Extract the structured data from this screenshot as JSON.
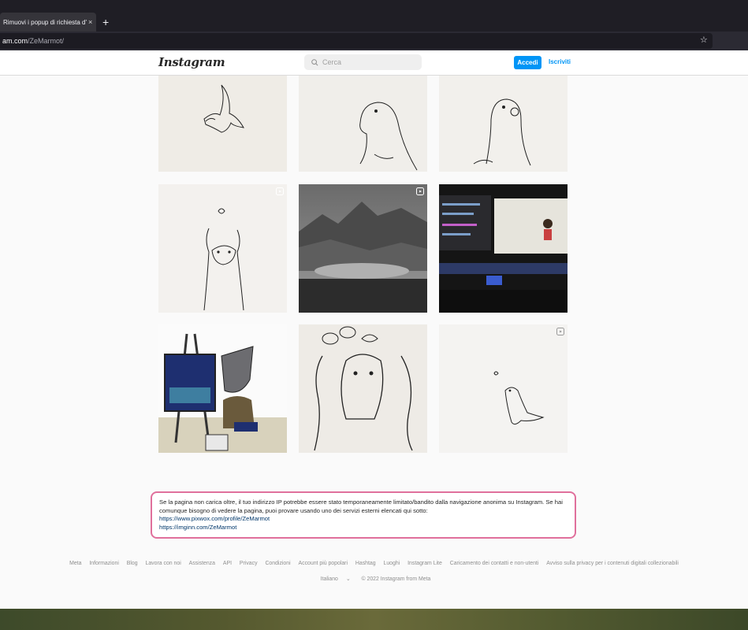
{
  "browser": {
    "tab_title": "Rimuovi i popup di richiesta d'acce",
    "tab_close": "×",
    "new_tab": "+",
    "url_host": "am.com",
    "url_path": "/ZeMarmot/"
  },
  "header": {
    "logo": "Instagram",
    "search_placeholder": "Cerca",
    "login_label": "Accedi",
    "signup_label": "Iscriviti"
  },
  "notice": {
    "text": "Se la pagina non carica oltre, il tuo indirizzo IP potrebbe essere stato temporaneamente limitato/bandito dalla navigazione anonima su Instagram. Se hai comunque bisogno di vedere la pagina, puoi provare usando uno dei servizi esterni elencati qui sotto:",
    "links": [
      "https://www.pixwox.com/profile/ZeMarmot",
      "https://imginn.com/ZeMarmot"
    ]
  },
  "footer": {
    "links": [
      "Meta",
      "Informazioni",
      "Blog",
      "Lavora con noi",
      "Assistenza",
      "API",
      "Privacy",
      "Condizioni",
      "Account più popolari",
      "Hashtag",
      "Luoghi",
      "Instagram Lite",
      "Caricamento dei contatti e non-utenti",
      "Avviso sulla privacy per i contenuti digitali collezionabili"
    ],
    "language": "Italiano",
    "copyright": "© 2022 Instagram from Meta"
  },
  "colors": {
    "accent": "#0095f6",
    "notice_border": "#e0709c"
  }
}
